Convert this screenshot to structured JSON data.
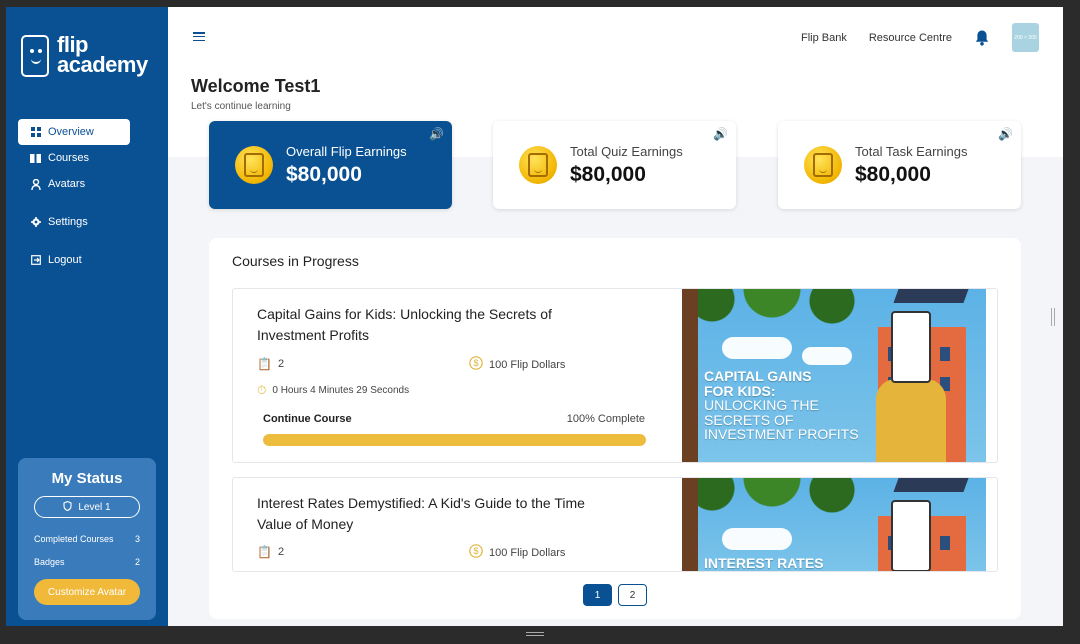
{
  "brand": {
    "line1": "flip",
    "line2": "academy"
  },
  "sidebar": {
    "items": [
      {
        "label": "Overview",
        "icon": "grid-icon"
      },
      {
        "label": "Courses",
        "icon": "book-icon"
      },
      {
        "label": "Avatars",
        "icon": "person-icon"
      },
      {
        "label": "Settings",
        "icon": "gear-icon"
      },
      {
        "label": "Logout",
        "icon": "logout-icon"
      }
    ]
  },
  "status": {
    "title": "My Status",
    "level": "Level 1",
    "completed_label": "Completed Courses",
    "completed_value": "3",
    "badges_label": "Badges",
    "badges_value": "2",
    "customize_label": "Customize Avatar"
  },
  "header": {
    "links": [
      "Flip Bank",
      "Resource Centre"
    ],
    "avatar_text": "200 × 200"
  },
  "welcome": {
    "title": "Welcome Test1",
    "subtitle": "Let's continue learning"
  },
  "earnings": [
    {
      "label": "Overall Flip Earnings",
      "amount": "$80,000"
    },
    {
      "label": "Total Quiz Earnings",
      "amount": "$80,000"
    },
    {
      "label": "Total Task Earnings",
      "amount": "$80,000"
    }
  ],
  "courses": {
    "title": "Courses in Progress",
    "items": [
      {
        "title": "Capital Gains for Kids: Unlocking the Secrets of Investment Profits",
        "quizzes": "2",
        "reward": "100 Flip Dollars",
        "time": "0 Hours 4 Minutes 29 Seconds",
        "continue_label": "Continue Course",
        "progress_text": "100% Complete",
        "progress": 1.0,
        "thumb_lines": [
          "CAPITAL GAINS",
          "FOR KIDS:",
          "UNLOCKING THE",
          "SECRETS OF",
          "INVESTMENT PROFITS"
        ]
      },
      {
        "title": "Interest Rates Demystified: A Kid's Guide to the Time Value of Money",
        "quizzes": "2",
        "reward": "100 Flip Dollars",
        "thumb_lines": [
          "INTEREST RATES"
        ]
      }
    ]
  },
  "pagination": {
    "pages": [
      "1",
      "2"
    ],
    "current": "1"
  },
  "colors": {
    "primary": "#0a5194",
    "accent": "#eebc3c",
    "status_bg": "#3a7bbb"
  }
}
